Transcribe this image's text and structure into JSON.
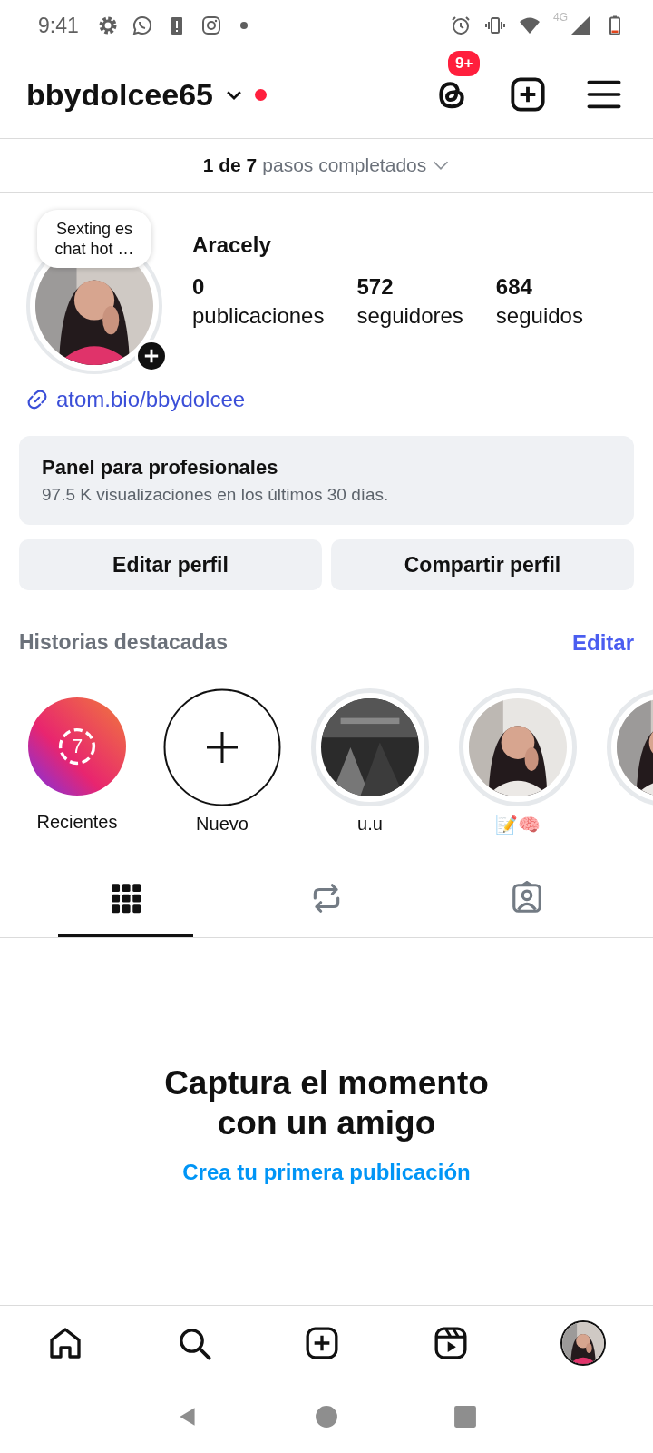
{
  "status_bar": {
    "time": "9:41",
    "network": "4G"
  },
  "header": {
    "username": "bbydolcee65",
    "unseen": true,
    "badge": "9+"
  },
  "setup_steps": {
    "count": "1 de 7",
    "label": "pasos completados"
  },
  "profile": {
    "note": "Sexting es chat hot …",
    "name": "Aracely",
    "stats": [
      {
        "value": "0",
        "label": "publicaciones"
      },
      {
        "value": "572",
        "label": "seguidores"
      },
      {
        "value": "684",
        "label": "seguidos"
      }
    ],
    "link": "atom.bio/bbydolcee"
  },
  "dashboard": {
    "title": "Panel para profesionales",
    "subtitle": "97.5 K visualizaciones en los últimos 30 días."
  },
  "buttons": [
    "Editar perfil",
    "Compartir perfil"
  ],
  "highlights": {
    "title": "Historias destacadas",
    "edit": "Editar",
    "items": [
      {
        "kind": "recent",
        "count": "7",
        "label": "Recientes"
      },
      {
        "kind": "new",
        "label": "Nuevo"
      },
      {
        "kind": "picture",
        "label": "u.u"
      },
      {
        "kind": "picture",
        "label": "📝🧠"
      },
      {
        "kind": "picture"
      }
    ]
  },
  "tabs": [
    {
      "kind": "grid",
      "selected": true
    },
    {
      "kind": "reposts",
      "selected": false
    },
    {
      "kind": "tagged",
      "selected": false
    }
  ],
  "empty_state": {
    "title": "Captura el momento\ncon un amigo",
    "link": "Crea tu primera publicación"
  },
  "bottom_nav": [
    {
      "kind": "home"
    },
    {
      "kind": "search"
    },
    {
      "kind": "create"
    },
    {
      "kind": "reels"
    },
    {
      "kind": "profile"
    }
  ]
}
